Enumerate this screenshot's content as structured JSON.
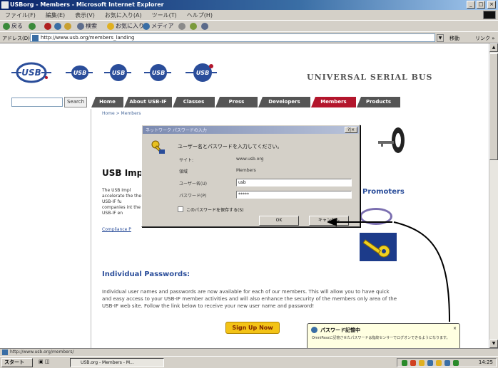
{
  "window": {
    "title": "USBorg - Members - Microsoft Internet Explorer",
    "controls": [
      "_",
      "□",
      "×"
    ]
  },
  "menubar": {
    "items": [
      "ファイル(F)",
      "編集(E)",
      "表示(V)",
      "お気に入り(A)",
      "ツール(T)",
      "ヘルプ(H)"
    ]
  },
  "toolbar": {
    "back_label": "戻る",
    "search_label": "検索",
    "favorites_label": "お気に入り",
    "media_label": "メディア"
  },
  "address": {
    "label": "アドレス(D)",
    "url": "http://www.usb.org/members_landing",
    "go_label": "移動",
    "links_label": "リンク »"
  },
  "page": {
    "brand": "UNIVERSAL SERIAL BUS",
    "search": {
      "placeholder": "",
      "button": "Search"
    },
    "nav_tabs": [
      {
        "label": "Home",
        "active": false
      },
      {
        "label": "About USB-IF",
        "active": false
      },
      {
        "label": "Classes",
        "active": false
      },
      {
        "label": "Press",
        "active": false
      },
      {
        "label": "Developers",
        "active": false
      },
      {
        "label": "Members",
        "active": true
      },
      {
        "label": "Products",
        "active": false
      }
    ],
    "breadcrumb": "Home > Members",
    "heading": "USB Imp",
    "promoters": "Promoters",
    "intro_text": "The USB Impl accelerate the the USB-IF fu companies int the USB-IF en",
    "intro_link": "Compliance P",
    "section_title": "Individual Passwords:",
    "body_text": "Individual user names and passwords are now available for each of our members. This will allow you to have quick and easy access to your USB-IF member activities and will also enhance the security of the members only area of the USB-IF web site. Follow the link below to receive your new user name and password!",
    "signup_label": "Sign Up Now"
  },
  "dialog": {
    "title": "ネットワーク パスワードの入力",
    "close": "?|×",
    "prompt": "ユーザー名とパスワードを入力してください。",
    "site_label": "サイト:",
    "site_value": "www.usb.org",
    "realm_label": "領域",
    "realm_value": "Members",
    "username_label": "ユーザー名(U)",
    "username_value": "usb",
    "password_label": "パスワード(P)",
    "password_value": "*****",
    "save_label": "このパスワードを保存する(S)",
    "ok_label": "OK",
    "cancel_label": "キャンセル"
  },
  "balloon": {
    "title": "パスワード記憶中",
    "close": "×",
    "body": "OmniPassに記憶させたパスワードは指紋センサーでログオンできるようになります。"
  },
  "statusbar": {
    "text": "http://www.usb.org/members/"
  },
  "taskbar": {
    "start_label": "スタート",
    "task_label": "USB.org - Members - M...",
    "clock": "14:25"
  },
  "colors": {
    "nav_tab": "#555555",
    "nav_active": "#b3162c",
    "link_blue": "#2a4d9a",
    "signup": "#f3c316",
    "dialog_face": "#d4d0c8"
  }
}
